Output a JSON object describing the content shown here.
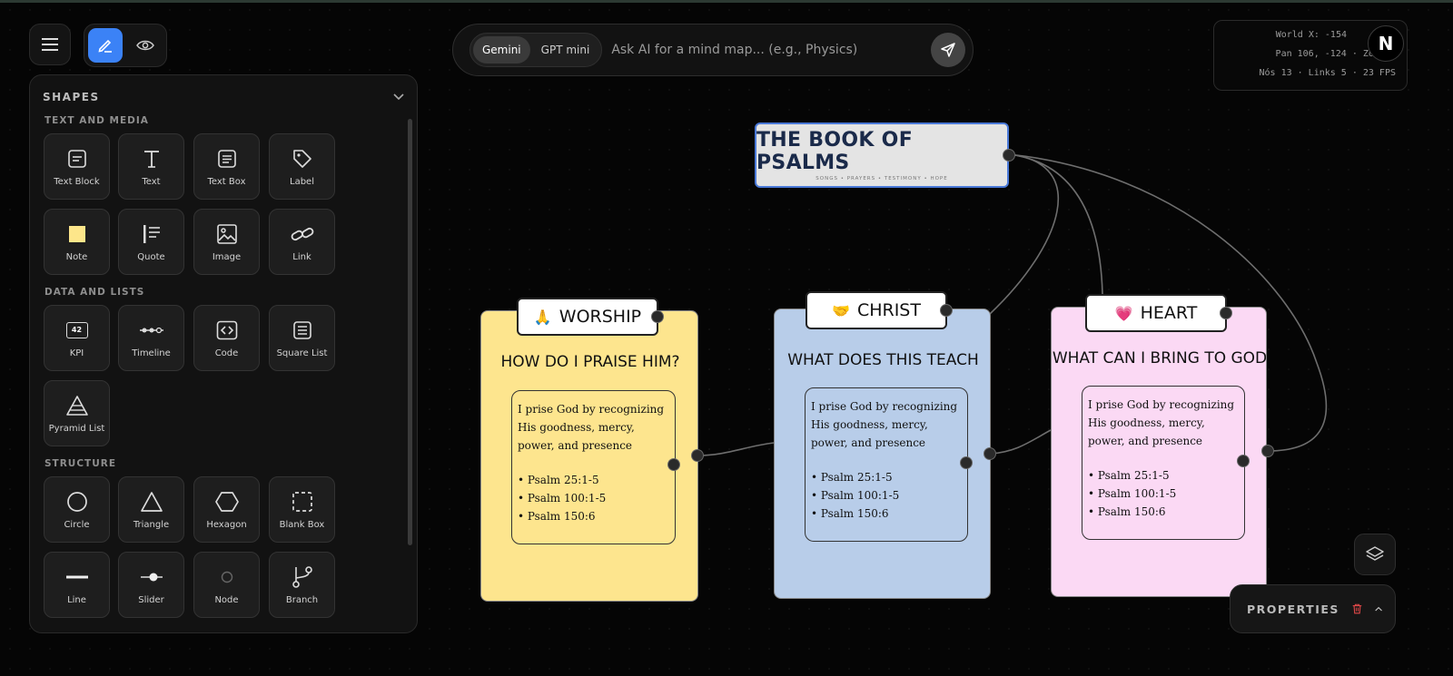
{
  "toolbar": {
    "menu_icon": "hamburger-icon",
    "edit_icon": "pen-icon",
    "view_icon": "eye-icon",
    "accent_color": "#3b82f6"
  },
  "shapes_panel": {
    "title": "SHAPES",
    "sections": [
      {
        "title": "TEXT AND MEDIA",
        "items": [
          {
            "label": "Text Block",
            "icon": "text-block-icon"
          },
          {
            "label": "Text",
            "icon": "text-icon"
          },
          {
            "label": "Text Box",
            "icon": "text-box-icon"
          },
          {
            "label": "Label",
            "icon": "tag-icon"
          },
          {
            "label": "Note",
            "icon": "note-icon"
          },
          {
            "label": "Quote",
            "icon": "quote-icon"
          },
          {
            "label": "Image",
            "icon": "image-icon"
          },
          {
            "label": "Link",
            "icon": "link-icon"
          }
        ]
      },
      {
        "title": "DATA AND LISTS",
        "items": [
          {
            "label": "KPI",
            "icon": "kpi-icon",
            "badge": "42"
          },
          {
            "label": "Timeline",
            "icon": "timeline-icon"
          },
          {
            "label": "Code",
            "icon": "code-icon"
          },
          {
            "label": "Square List",
            "icon": "square-list-icon"
          },
          {
            "label": "Pyramid List",
            "icon": "pyramid-icon"
          }
        ]
      },
      {
        "title": "STRUCTURE",
        "items": [
          {
            "label": "Circle",
            "icon": "circle-icon"
          },
          {
            "label": "Triangle",
            "icon": "triangle-icon"
          },
          {
            "label": "Hexagon",
            "icon": "hexagon-icon"
          },
          {
            "label": "Blank Box",
            "icon": "blank-box-icon"
          },
          {
            "label": "Line",
            "icon": "line-icon"
          },
          {
            "label": "Slider",
            "icon": "slider-icon"
          },
          {
            "label": "Node",
            "icon": "node-icon"
          },
          {
            "label": "Branch",
            "icon": "branch-icon"
          }
        ]
      }
    ]
  },
  "ai_bar": {
    "models": [
      "Gemini",
      "GPT mini"
    ],
    "active_model": "Gemini",
    "placeholder": "Ask AI for a mind map... (e.g., Physics)"
  },
  "stats": {
    "line1": "World X: -154",
    "line2": "Pan 106, -124 · Zoom 6",
    "line3": "Nós 13 · Links 5 · 23 FPS",
    "logo": "N"
  },
  "title_node": {
    "title": "THE BOOK OF PSALMS",
    "subtitle": "SONGS • PRAYERS • TESTIMONY • HOPE",
    "border_color": "#4a79d8"
  },
  "cards": [
    {
      "tab_emoji": "🙏",
      "tab_label": "WORSHIP",
      "question": "HOW DO I PRAISE HIM?",
      "body": "I prise God by recognizing His goodness, mercy, power, and presence",
      "bullets": [
        "• Psalm 25:1-5",
        "• Psalm 100:1-5",
        "• Psalm 150:6"
      ],
      "color": "#fde58e"
    },
    {
      "tab_emoji": "🤝",
      "tab_label": "CHRIST",
      "question": "WHAT DOES THIS TEACH",
      "body": "I prise God by recognizing His goodness, mercy, power, and presence",
      "bullets": [
        "• Psalm 25:1-5",
        "• Psalm 100:1-5",
        "• Psalm 150:6"
      ],
      "color": "#b8cde9"
    },
    {
      "tab_emoji": "💗",
      "tab_label": "HEART",
      "question": "WHAT CAN I BRING TO GOD",
      "body": "I prise God by recognizing His goodness, mercy, power, and presence",
      "bullets": [
        "• Psalm 25:1-5",
        "• Psalm 100:1-5",
        "• Psalm 150:6"
      ],
      "color": "#fbd9f4"
    }
  ],
  "properties": {
    "label": "PROPERTIES",
    "delete_icon": "trash-icon",
    "collapse_icon": "chevron-up-icon",
    "layers_icon": "layers-icon"
  }
}
